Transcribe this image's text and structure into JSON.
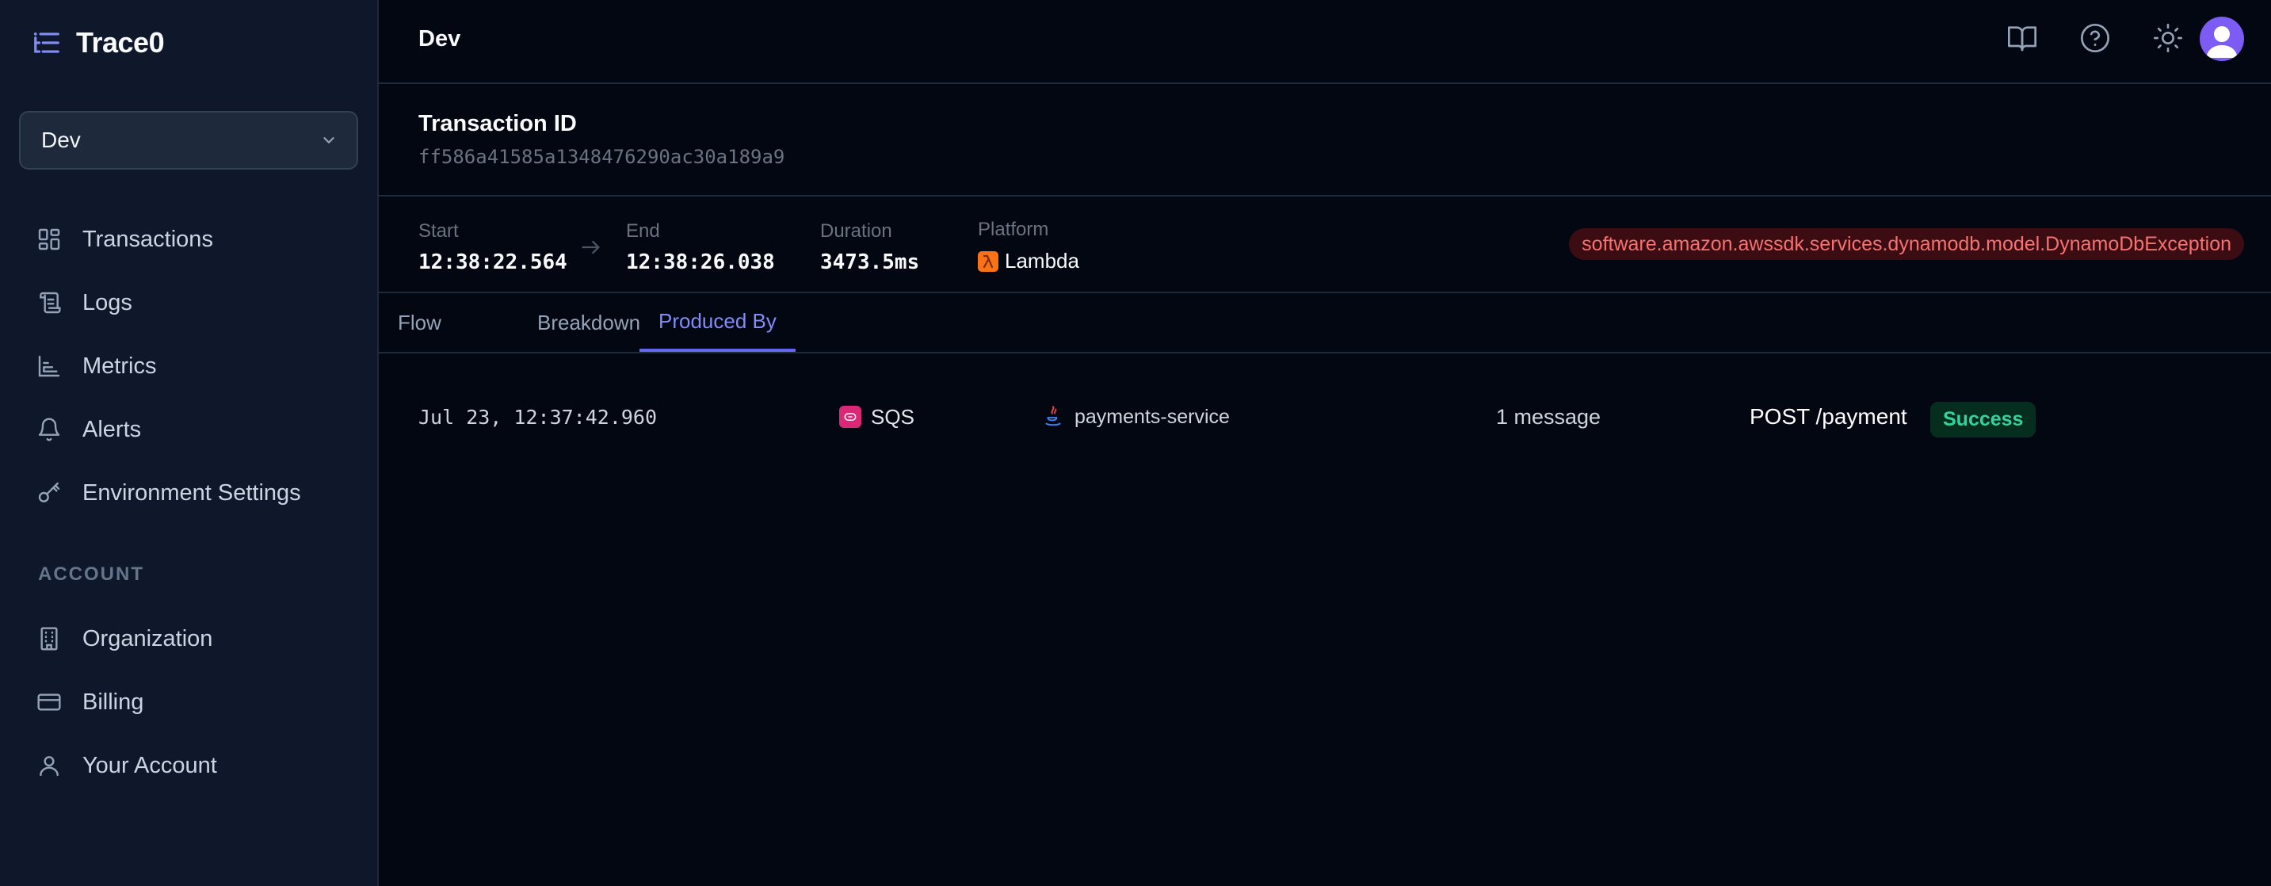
{
  "brand": {
    "name": "Trace0"
  },
  "sidebar": {
    "environment": "Dev",
    "nav": [
      {
        "label": "Transactions",
        "icon": "grid-icon"
      },
      {
        "label": "Logs",
        "icon": "scroll-icon"
      },
      {
        "label": "Metrics",
        "icon": "bar-chart-icon"
      },
      {
        "label": "Alerts",
        "icon": "bell-icon"
      },
      {
        "label": "Environment Settings",
        "icon": "key-icon"
      }
    ],
    "account_section": "ACCOUNT",
    "account_nav": [
      {
        "label": "Organization",
        "icon": "building-icon"
      },
      {
        "label": "Billing",
        "icon": "credit-card-icon"
      },
      {
        "label": "Your Account",
        "icon": "user-icon"
      }
    ]
  },
  "header": {
    "title": "Dev",
    "icons": [
      "book-icon",
      "help-icon",
      "sun-icon",
      "avatar-icon"
    ]
  },
  "transaction": {
    "label": "Transaction ID",
    "id": "ff586a41585a1348476290ac30a189a9"
  },
  "info": {
    "start_label": "Start",
    "start_value": "12:38:22.564",
    "end_label": "End",
    "end_value": "12:38:26.038",
    "duration_label": "Duration",
    "duration_value": "3473.5ms",
    "platform_label": "Platform",
    "platform_value": "Lambda",
    "exception": "software.amazon.awssdk.services.dynamodb.model.DynamoDbException"
  },
  "tabs": [
    {
      "label": "Flow",
      "active": false
    },
    {
      "label": "Breakdown",
      "active": false
    },
    {
      "label": "Produced By",
      "active": true
    }
  ],
  "rows": [
    {
      "timestamp": "Jul 23, 12:37:42.960",
      "source": "SQS",
      "service": "payments-service",
      "messages": "1 message",
      "endpoint": "POST /payment",
      "status": "Success"
    }
  ],
  "colors": {
    "accent": "#6366f1",
    "background": "#030712",
    "sidebar": "#0f172a",
    "success": "#34d399",
    "error": "#f87171",
    "lambda": "#f97316",
    "sqs": "#db2777"
  }
}
